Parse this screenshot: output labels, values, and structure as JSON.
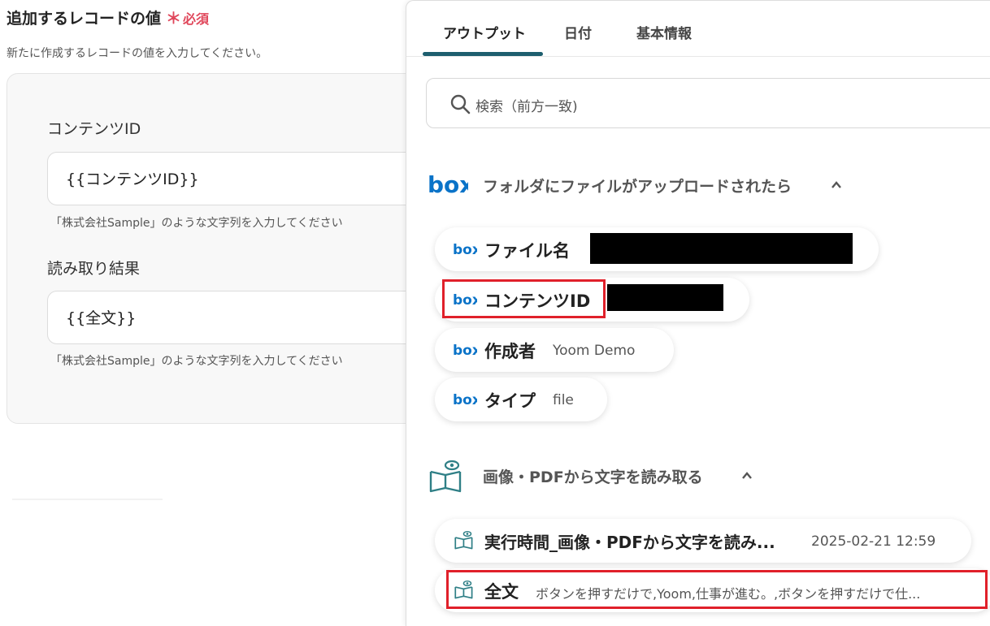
{
  "form": {
    "title": "追加するレコードの値",
    "required_mark": "＊",
    "required_label": "必須",
    "description": "新たに作成するレコードの値を入力してください。",
    "fields": [
      {
        "label": "コンテンツID",
        "value": "{{コンテンツID}}",
        "hint": "「株式会社Sample」のような文字列を入力してください"
      },
      {
        "label": "読み取り結果",
        "value": "{{全文}}",
        "hint": "「株式会社Sample」のような文字列を入力してください"
      }
    ]
  },
  "panel": {
    "tabs": [
      "アウトプット",
      "日付",
      "基本情報"
    ],
    "active_tab": "アウトプット",
    "search_placeholder": "検索（前方一致)",
    "sections": [
      {
        "icon": "box-logo-icon",
        "logo_text": "box",
        "title": "フォルダにファイルがアップロードされたら",
        "items": [
          {
            "label": "ファイル名",
            "value": "",
            "redacted": true
          },
          {
            "label": "コンテンツID",
            "value": "",
            "redacted": true,
            "highlighted": true
          },
          {
            "label": "作成者",
            "value": "Yoom Demo"
          },
          {
            "label": "タイプ",
            "value": "file"
          }
        ]
      },
      {
        "icon": "ocr-book-eye-icon",
        "title": "画像・PDFから文字を読み取る",
        "items": [
          {
            "label": "実行時間_画像・PDFから文字を読み...",
            "value": "2025-02-21 12:59"
          },
          {
            "label": "全文",
            "value": "ボタンを押すだけで,Yoom,仕事が進む。,ボタンを押すだけで仕...",
            "highlighted": true
          }
        ]
      }
    ]
  },
  "colors": {
    "accent": "#1d5e6e",
    "required": "#e0475b",
    "box_blue": "#0a73c8",
    "highlight": "#e0202a",
    "ocr_icon": "#2f7f86"
  }
}
